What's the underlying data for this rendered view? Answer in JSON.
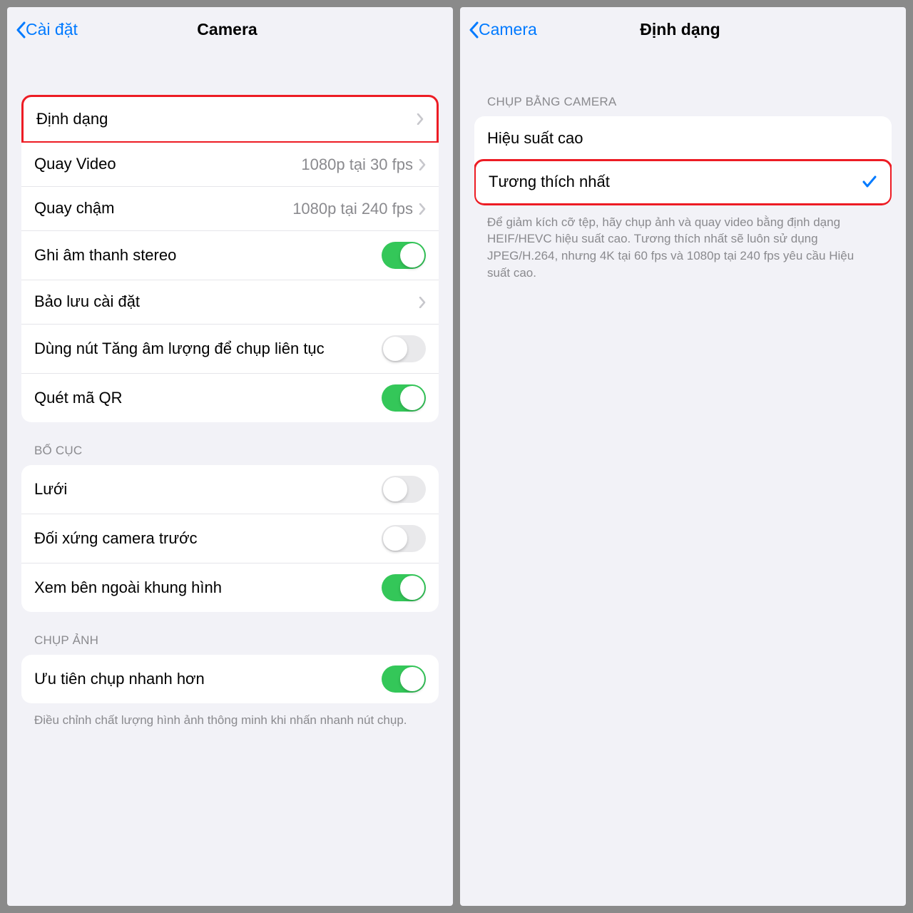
{
  "left": {
    "back_label": "Cài đặt",
    "title": "Camera",
    "rows": {
      "format": {
        "label": "Định dạng"
      },
      "record_video": {
        "label": "Quay Video",
        "value": "1080p tại 30 fps"
      },
      "slow_mo": {
        "label": "Quay chậm",
        "value": "1080p tại 240 fps"
      },
      "stereo": {
        "label": "Ghi âm thanh stereo"
      },
      "preserve": {
        "label": "Bảo lưu cài đặt"
      },
      "volume_burst": {
        "label": "Dùng nút Tăng âm lượng để chụp liên tục"
      },
      "qr": {
        "label": "Quét mã QR"
      }
    },
    "section_layout": "BỐ CỤC",
    "layout_rows": {
      "grid": {
        "label": "Lưới"
      },
      "mirror": {
        "label": "Đối xứng camera trước"
      },
      "outside_frame": {
        "label": "Xem bên ngoài khung hình"
      }
    },
    "section_capture": "CHỤP ẢNH",
    "capture_rows": {
      "faster": {
        "label": "Ưu tiên chụp nhanh hơn"
      }
    },
    "capture_footer": "Điều chỉnh chất lượng hình ảnh thông minh khi nhấn nhanh nút chụp."
  },
  "right": {
    "back_label": "Camera",
    "title": "Định dạng",
    "section_capture": "CHỤP BẰNG CAMERA",
    "rows": {
      "high_eff": {
        "label": "Hiệu suất cao"
      },
      "compat": {
        "label": "Tương thích nhất"
      }
    },
    "footer": "Để giảm kích cỡ tệp, hãy chụp ảnh và quay video bằng định dạng HEIF/HEVC hiệu suất cao. Tương thích nhất sẽ luôn sử dụng JPEG/H.264, nhưng 4K tại 60 fps và 1080p tại 240 fps yêu cầu Hiệu suất cao."
  }
}
